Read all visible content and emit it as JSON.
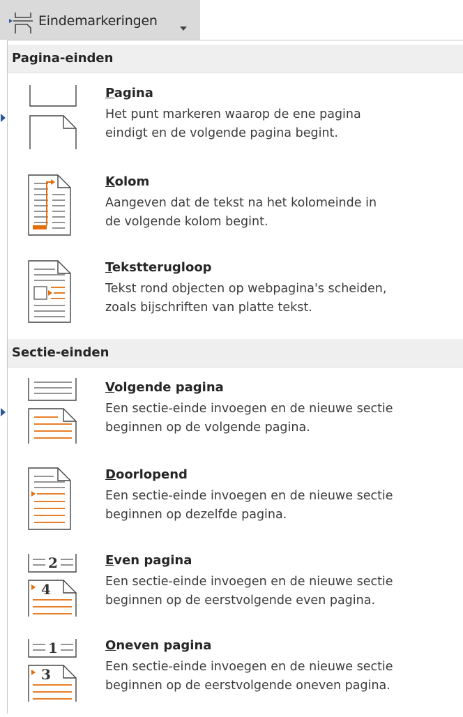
{
  "button": {
    "label": "Eindemarkeringen",
    "icon": "page-break-icon",
    "caret": "dropdown-caret-icon"
  },
  "sections": [
    {
      "header": "Pagina-einden"
    },
    {
      "header": "Sectie-einden"
    }
  ],
  "items": [
    {
      "title_first": "P",
      "title_rest": "agina",
      "desc_line1": "Het punt markeren waarop de ene pagina",
      "desc_line2": "eindigt en de volgende pagina begint.",
      "icon": "page-break-icon"
    },
    {
      "title_first": "K",
      "title_rest": "olom",
      "desc_line1": "Aangeven dat de tekst na het kolomeinde in",
      "desc_line2": "de volgende kolom begint.",
      "icon": "column-break-icon"
    },
    {
      "title_first": "T",
      "title_rest": "ekstterugloop",
      "desc_line1": "Tekst rond objecten op webpagina's scheiden,",
      "desc_line2": "zoals bijschriften van platte tekst.",
      "icon": "text-wrapping-break-icon"
    },
    {
      "title_first": "V",
      "title_rest": "olgende pagina",
      "desc_line1": "Een sectie-einde invoegen en de nieuwe sectie",
      "desc_line2": "beginnen op de volgende pagina.",
      "icon": "next-page-section-break-icon"
    },
    {
      "title_first": "D",
      "title_rest": "oorlopend",
      "desc_line1": "Een sectie-einde invoegen en de nieuwe sectie",
      "desc_line2": "beginnen op dezelfde pagina.",
      "icon": "continuous-section-break-icon"
    },
    {
      "title_first": "E",
      "title_rest": "ven pagina",
      "desc_line1": "Een sectie-einde invoegen en de nieuwe sectie",
      "desc_line2": "beginnen op de eerstvolgende even pagina.",
      "icon": "even-page-section-break-icon",
      "num_top": "2",
      "num_bottom": "4"
    },
    {
      "title_first": "O",
      "title_rest": "neven pagina",
      "desc_line1": "Een sectie-einde invoegen en de nieuwe sectie",
      "desc_line2": "beginnen op de eerstvolgende oneven pagina.",
      "icon": "odd-page-section-break-icon",
      "num_top": "1",
      "num_bottom": "3"
    }
  ],
  "colors": {
    "accent": "#e46c0a",
    "marker": "#2b579a",
    "header_bg": "#efefef",
    "button_bg": "#dadada"
  }
}
